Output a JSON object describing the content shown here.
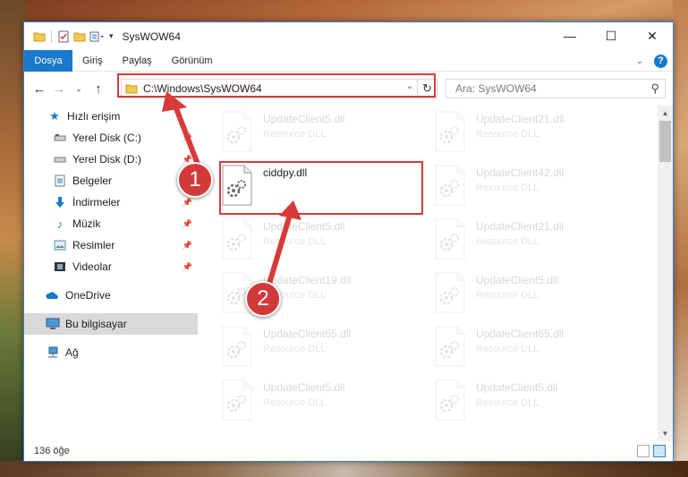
{
  "window": {
    "title": "SysWOW64",
    "controls": {
      "minimize": "—",
      "maximize": "☐",
      "close": "✕"
    }
  },
  "ribbon": {
    "file_tab": "Dosya",
    "tabs": [
      "Giriş",
      "Paylaş",
      "Görünüm"
    ],
    "help": "?"
  },
  "navigation": {
    "address": "C:\\Windows\\SysWOW64",
    "search_placeholder": "Ara: SysWOW64"
  },
  "sidebar": {
    "items": [
      {
        "label": "Hızlı erişim",
        "icon": "star-icon"
      },
      {
        "label": "Yerel Disk (C:)",
        "icon": "drive-icon",
        "pinned": true
      },
      {
        "label": "Yerel Disk (D:)",
        "icon": "drive-icon",
        "pinned": true
      },
      {
        "label": "Belgeler",
        "icon": "documents-icon",
        "pinned": true
      },
      {
        "label": "İndirmeler",
        "icon": "download-icon",
        "pinned": true
      },
      {
        "label": "Müzik",
        "icon": "music-icon",
        "pinned": true
      },
      {
        "label": "Resimler",
        "icon": "pictures-icon",
        "pinned": true
      },
      {
        "label": "Videolar",
        "icon": "videos-icon",
        "pinned": true
      },
      {
        "label": "OneDrive",
        "icon": "onedrive-icon"
      },
      {
        "label": "Bu bilgisayar",
        "icon": "computer-icon",
        "selected": true
      },
      {
        "label": "Ağ",
        "icon": "network-icon"
      }
    ]
  },
  "files": {
    "col1": [
      {
        "name": "UpdateClient5.dll",
        "type": "Resource DLL"
      },
      {
        "name": "ciddpy.dll",
        "type": ""
      },
      {
        "name": "UpdateClient5.dll",
        "type": "Resource DLL"
      },
      {
        "name": "UpdateClient19.dll",
        "type": "Resource DLL"
      },
      {
        "name": "UpdateClient65.dll",
        "type": "Resource DLL"
      },
      {
        "name": "UpdateClient5.dll",
        "type": "Resource DLL"
      }
    ],
    "col2": [
      {
        "name": "UpdateClient21.dll",
        "type": "Resource DLL"
      },
      {
        "name": "UpdateClient42.dll",
        "type": "Resource DLL"
      },
      {
        "name": "UpdateClient21.dll",
        "type": "Resource DLL"
      },
      {
        "name": "UpdateClient5.dll",
        "type": "Resource DLL"
      },
      {
        "name": "UpdateClient65.dll",
        "type": "Resource DLL"
      },
      {
        "name": "UpdateClient5.dll",
        "type": "Resource DLL"
      }
    ]
  },
  "status": {
    "item_count": "136 öğe"
  },
  "annotations": {
    "step1": "1",
    "step2": "2",
    "color": "#d83a3a"
  }
}
